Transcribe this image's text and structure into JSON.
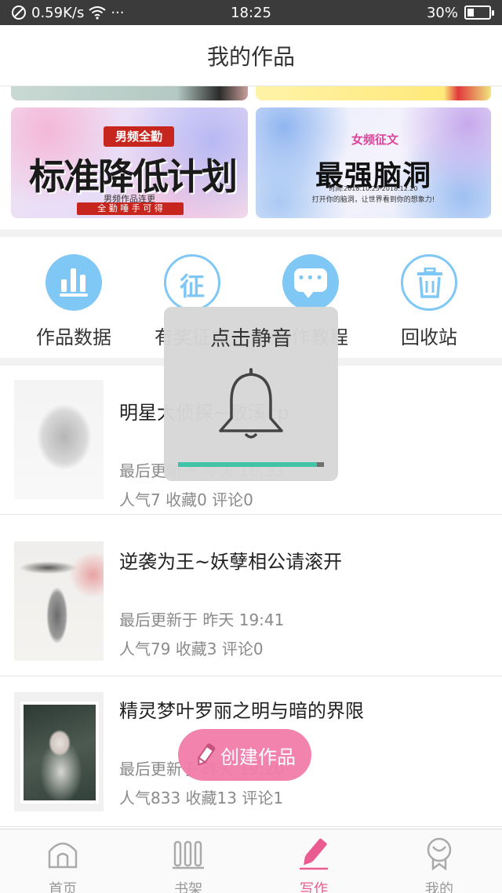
{
  "status_bar": {
    "speed": "0.59K/s",
    "more": "···",
    "time": "18:25",
    "battery": "30%",
    "battery_level": 0.3
  },
  "header": {
    "title": "我的作品"
  },
  "banners": [
    {
      "tag": "男频全勤",
      "title": "标准降低计划",
      "sub1": "男频作品连更",
      "sub2": "全 勤 唾 手 可 得"
    },
    {
      "tag": "女频征文",
      "title": "最强脑洞",
      "date": "时间:2018.10.25-2018.12.20",
      "sub": "打开你的脑洞，让世界看到你的想象力!"
    }
  ],
  "features": [
    {
      "label": "作品数据",
      "icon": "bar-chart-icon"
    },
    {
      "label": "有奖征文",
      "icon": "zheng-icon",
      "glyph": "征"
    },
    {
      "label": "写作教程",
      "icon": "chat-bubble-icon"
    },
    {
      "label": "回收站",
      "icon": "trash-icon"
    }
  ],
  "works": [
    {
      "title": "明星大侦探~敬溪cp",
      "updated": "最后更新于 今天 16:33",
      "stats": "人气7 收藏0 评论0"
    },
    {
      "title": "逆袭为王~妖孽相公请滚开",
      "updated": "最后更新于 昨天 19:41",
      "stats": "人气79 收藏3 评论0"
    },
    {
      "title": "精灵梦叶罗丽之明与暗的界限",
      "updated": "最后更新于 昨天 19:20",
      "stats": "人气833 收藏13 评论1"
    }
  ],
  "mute_popup": {
    "title": "点击静音",
    "volume": 0.95
  },
  "create_button": {
    "label": "创建作品"
  },
  "bottom_nav": [
    {
      "label": "首页",
      "icon": "home-icon",
      "active": false
    },
    {
      "label": "书架",
      "icon": "bookshelf-icon",
      "active": false
    },
    {
      "label": "写作",
      "icon": "pencil-icon",
      "active": true
    },
    {
      "label": "我的",
      "icon": "profile-icon",
      "active": false
    }
  ],
  "colors": {
    "accent_blue": "#7fc8f5",
    "accent_pink": "#f17eaa",
    "active_nav": "#ea5b8f",
    "progress": "#40c3a7"
  }
}
